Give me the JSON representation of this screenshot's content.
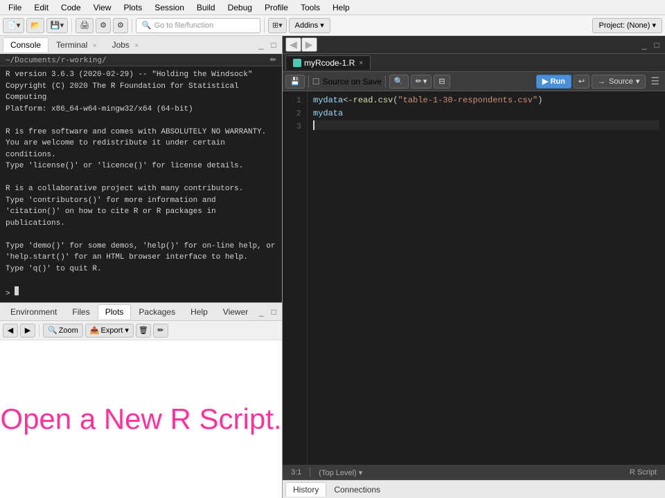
{
  "menubar": {
    "items": [
      "File",
      "Edit",
      "Code",
      "View",
      "Plots",
      "Session",
      "Build",
      "Debug",
      "Profile",
      "Tools",
      "Help"
    ]
  },
  "toolbar": {
    "go_to_file_placeholder": "Go to file/function",
    "addins_label": "Addins",
    "project_label": "Project: (None)"
  },
  "console_panel": {
    "tabs": [
      {
        "label": "Console",
        "active": true
      },
      {
        "label": "Terminal",
        "active": false,
        "closeable": true
      },
      {
        "label": "Jobs",
        "active": false,
        "closeable": true
      }
    ],
    "path": "~/Documents/r-working/",
    "output": [
      "R version 3.6.3 (2020-02-29) -- \"Holding the Windsock\"",
      "Copyright (C) 2020 The R Foundation for Statistical Computing",
      "Platform: x86_64-w64-mingw32/x64 (64-bit)",
      "",
      "R is free software and comes with ABSOLUTELY NO WARRANTY.",
      "You are welcome to redistribute it under certain conditions.",
      "Type 'license()' or 'licence()' for license details.",
      "",
      "R is a collaborative project with many contributors.",
      "Type 'contributors()' for more information and",
      "'citation()' on how to cite R or R packages in publications.",
      "",
      "Type 'demo()' for some demos, 'help()' for on-line help, or",
      "'help.start()' for an HTML browser interface to help.",
      "Type 'q()' to quit R.",
      "",
      ">"
    ]
  },
  "bottom_left_panel": {
    "tabs": [
      {
        "label": "Environment",
        "active": false
      },
      {
        "label": "Files",
        "active": false
      },
      {
        "label": "Plots",
        "active": true
      },
      {
        "label": "Packages",
        "active": false
      },
      {
        "label": "Help",
        "active": false
      },
      {
        "label": "Viewer",
        "active": false
      }
    ],
    "plots_message": "Open a New R Script."
  },
  "editor": {
    "nav_back": "◀",
    "nav_forward": "▶",
    "tab_filename": "myRcode-1.R",
    "toolbar": {
      "save_icon": "💾",
      "source_on_save_label": "Source on Save",
      "search_icon": "🔍",
      "edit_icon": "✏️",
      "run_label": "▶ Run",
      "rerun_icon": "↩",
      "source_label": "Source",
      "source_arrow": "▼",
      "menu_icon": "☰"
    },
    "lines": [
      {
        "number": "1",
        "content": [
          {
            "type": "var",
            "text": "mydata"
          },
          {
            "type": "op",
            "text": " <- "
          },
          {
            "type": "func",
            "text": "read.csv"
          },
          {
            "type": "op",
            "text": "("
          },
          {
            "type": "string",
            "text": "\"table-1-30-respondents.csv\""
          },
          {
            "type": "op",
            "text": ")"
          }
        ]
      },
      {
        "number": "2",
        "content": [
          {
            "type": "var",
            "text": "mydata"
          }
        ]
      },
      {
        "number": "3",
        "content": [],
        "cursor": true
      }
    ],
    "status": {
      "position": "3:1",
      "level": "(Top Level)",
      "language": "R Script"
    }
  },
  "bottom_tabs": {
    "tabs": [
      {
        "label": "History",
        "active": true
      },
      {
        "label": "Connections",
        "active": false
      }
    ]
  }
}
